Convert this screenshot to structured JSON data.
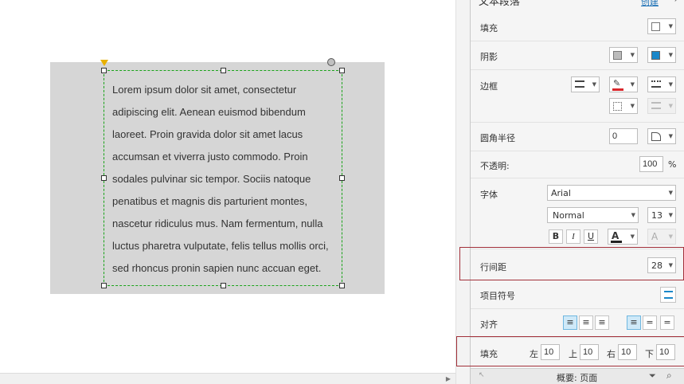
{
  "canvas": {
    "text": "Lorem ipsum dolor sit amet, consectetur adipiscing elit. Aenean euismod bibendum laoreet. Proin gravida dolor sit amet lacus accumsan et viverra justo commodo. Proin sodales pulvinar sic tempor. Sociis natoque penatibus et magnis dis parturient montes, nascetur ridiculus mus. Nam fermentum, nulla luctus pharetra vulputate, felis tellus mollis orci, sed rhoncus pronin sapien nunc accuan eget."
  },
  "panel": {
    "header_title": "文本段落",
    "header_link": "创建",
    "fill_label": "填充",
    "shadow_label": "阴影",
    "border_label": "边框",
    "radius_label": "圆角半径",
    "radius_value": "0",
    "opacity_label": "不透明:",
    "opacity_value": "100",
    "opacity_unit": "%",
    "font_label": "字体",
    "font_family": "Arial",
    "font_weight": "Normal",
    "font_size": "13",
    "bold": "B",
    "italic": "I",
    "underline": "U",
    "line_spacing_label": "行间距",
    "line_spacing_value": "28",
    "bullet_label": "项目符号",
    "align_label": "对齐",
    "padding_label": "填充",
    "pad_left_label": "左",
    "pad_left": "10",
    "pad_top_label": "上",
    "pad_top": "10",
    "pad_right_label": "右",
    "pad_right": "10",
    "pad_bottom_label": "下",
    "pad_bottom": "10",
    "footer_label": "概要: 页面"
  },
  "colors": {
    "shadow_color": "#1a87c9",
    "border_color": "#d9262b",
    "highlight": "#a2303a",
    "selection": "#19a319"
  }
}
